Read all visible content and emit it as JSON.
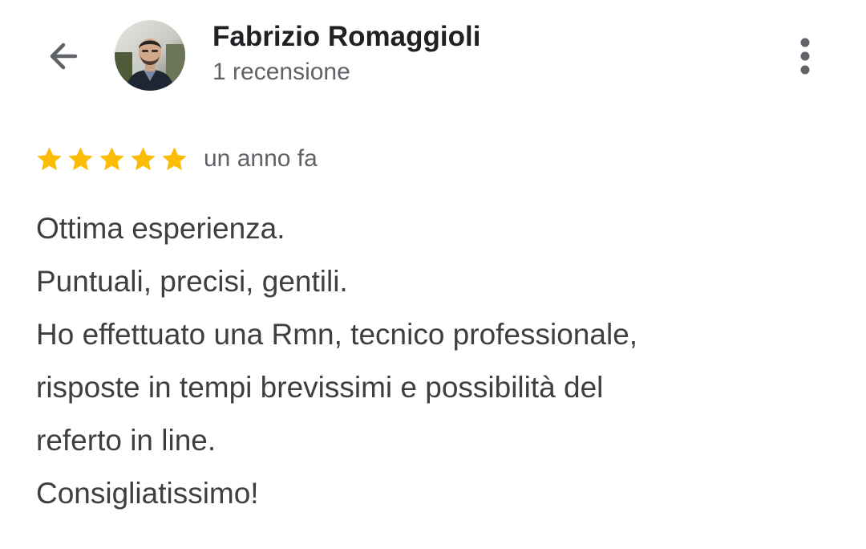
{
  "header": {
    "reviewer_name": "Fabrizio Romaggioli",
    "review_count": "1 recensione",
    "back_icon": "arrow-back-icon",
    "more_icon": "more-vert-icon"
  },
  "review": {
    "rating": 5,
    "rating_max": 5,
    "star_color": "#FBBC04",
    "date": "un anno fa",
    "lines": [
      "Ottima esperienza.",
      "Puntuali, precisi, gentili.",
      "Ho effettuato una Rmn, tecnico professionale,",
      "risposte in tempi brevissimi e possibilità del",
      "referto in line.",
      "Consigliatissimo!"
    ]
  }
}
